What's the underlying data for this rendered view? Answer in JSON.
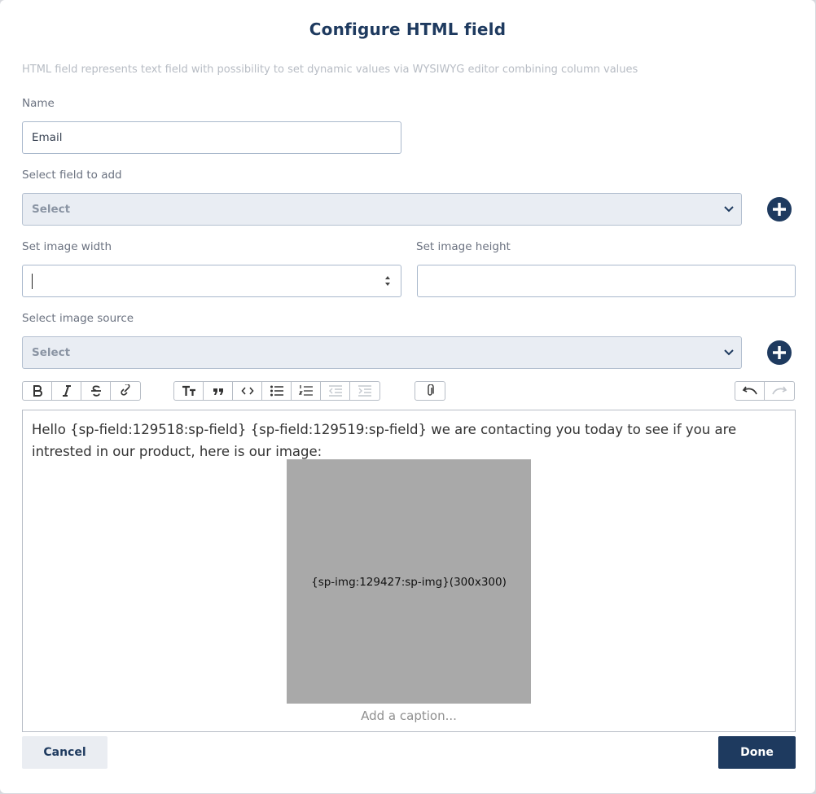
{
  "dialog": {
    "title": "Configure HTML field",
    "description": "HTML field represents text field with possibility to set dynamic values via WYSIWYG editor combining column values"
  },
  "name_field": {
    "label": "Name",
    "value": "Email"
  },
  "field_select": {
    "label": "Select field to add",
    "value": "Select"
  },
  "image_width": {
    "label": "Set image width",
    "value": ""
  },
  "image_height": {
    "label": "Set image height",
    "value": ""
  },
  "image_source": {
    "label": "Select image source",
    "value": "Select"
  },
  "toolbar": {
    "icons": [
      "bold-icon",
      "italic-icon",
      "strikethrough-icon",
      "link-icon",
      "heading-icon",
      "quote-icon",
      "code-icon",
      "bullet-list-icon",
      "numbered-list-icon",
      "outdent-icon",
      "indent-icon",
      "attachment-icon",
      "undo-icon",
      "redo-icon"
    ]
  },
  "editor": {
    "text": "Hello {sp-field:129518:sp-field} {sp-field:129519:sp-field} we are contacting you today to see if you are intrested in our product, here is our image:",
    "image_placeholder": "{sp-img:129427:sp-img}(300x300)",
    "caption_placeholder": "Add a caption..."
  },
  "buttons": {
    "cancel": "Cancel",
    "done": "Done"
  },
  "colors": {
    "primary": "#1e3a5f",
    "select_bg": "#e9edf3",
    "image_bg": "#a9a9a9"
  }
}
